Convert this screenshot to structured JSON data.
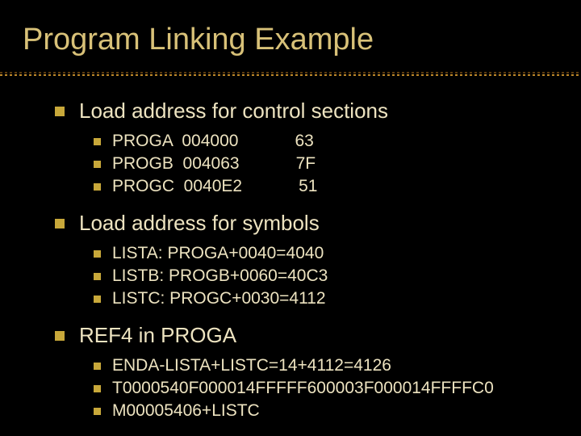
{
  "title": "Program Linking Example",
  "sections": [
    {
      "heading": "Load address for control sections",
      "items": [
        "PROGA  004000            63",
        "PROGB  004063            7F",
        "PROGC  0040E2            51"
      ]
    },
    {
      "heading": "Load address for symbols",
      "items": [
        "LISTA: PROGA+0040=4040",
        "LISTB: PROGB+0060=40C3",
        "LISTC: PROGC+0030=4112"
      ]
    },
    {
      "heading": "REF4 in PROGA",
      "items": [
        "ENDA-LISTA+LISTC=14+4112=4126",
        "T0000540F000014FFFFF600003F000014FFFFC0",
        "M00005406+LISTC"
      ]
    }
  ]
}
